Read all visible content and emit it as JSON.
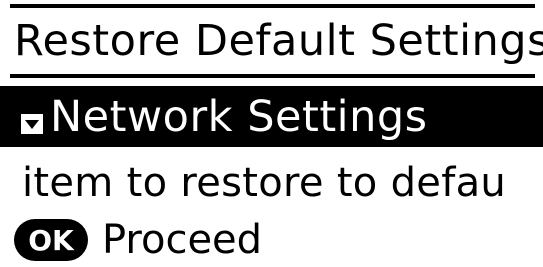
{
  "screen": {
    "title": "Restore Default Settings",
    "selected_item": {
      "label": "Network Settings",
      "icon": "chevron-down-icon"
    },
    "message": "item to restore to defau",
    "action": {
      "key_label": "OK",
      "label": "Proceed"
    }
  },
  "colors": {
    "background": "#ffffff",
    "foreground": "#000000",
    "highlight_bg": "#000000",
    "highlight_fg": "#ffffff"
  }
}
